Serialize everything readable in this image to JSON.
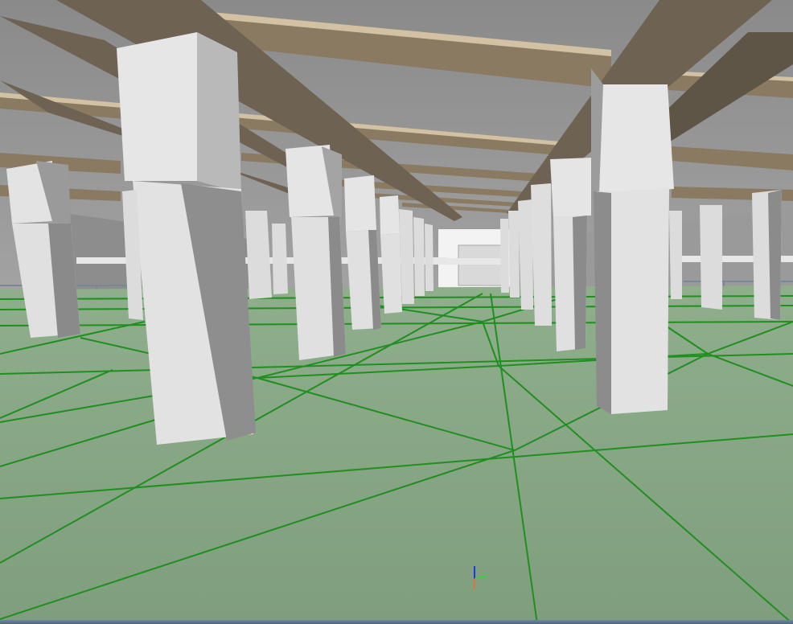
{
  "viewport": {
    "type": "3d-model-view",
    "floor_color": "#86a784",
    "floor_grid_color": "#1f8f1f",
    "ceiling_color": "#8e8e8e",
    "beam_color": "#8a7a62",
    "beam_highlight_color": "#cdb99b",
    "column_light_color": "#e2e2e2",
    "column_shadow_color": "#8c8c8c"
  },
  "axis_triad": {
    "icon": "xyz-axis-triad-icon",
    "x_color": "#e0733a",
    "y_color": "#3fcf3f",
    "z_color": "#1f35e6"
  }
}
